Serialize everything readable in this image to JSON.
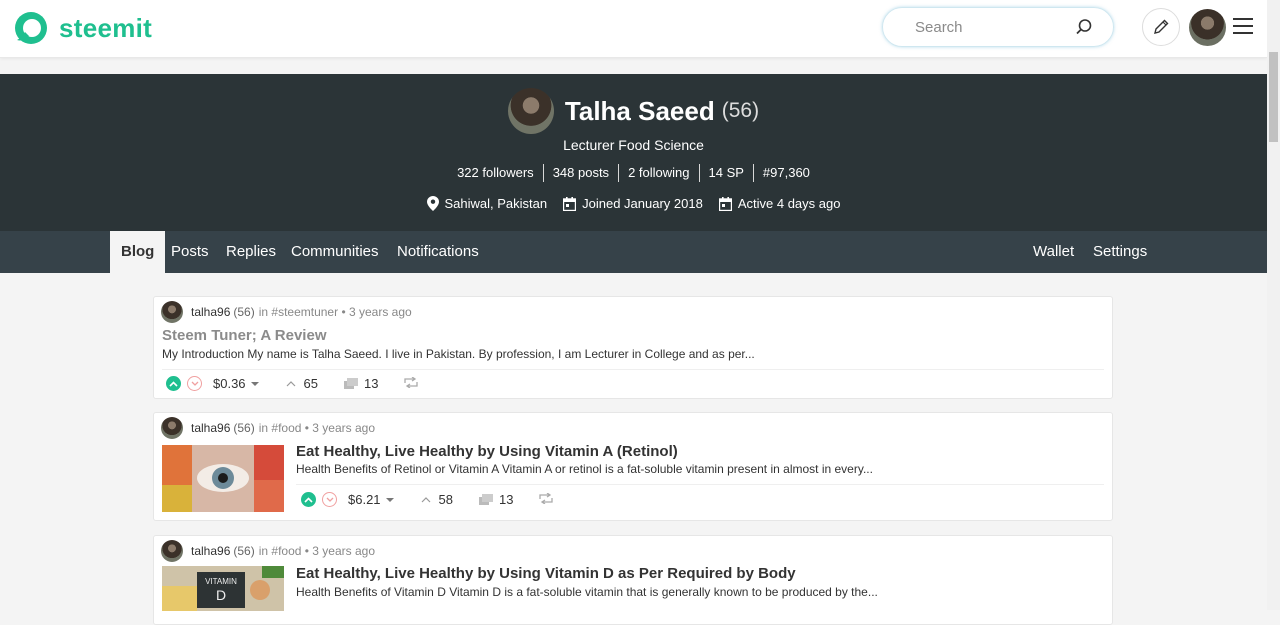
{
  "brand": {
    "name": "steemit",
    "color": "#1fbf8f"
  },
  "search": {
    "placeholder": "Search"
  },
  "header": {
    "pen_icon": "pencil-icon",
    "menu_icon": "hamburger-icon"
  },
  "profile": {
    "name": "Talha Saeed",
    "reputation": "(56)",
    "about": "Lecturer Food Science",
    "stats": [
      "322 followers",
      "348 posts",
      "2 following",
      "14 SP",
      "#97,360"
    ],
    "location": "Sahiwal, Pakistan",
    "joined": "Joined January 2018",
    "active": "Active 4 days ago"
  },
  "nav": {
    "left": [
      "Blog",
      "Posts",
      "Replies",
      "Communities",
      "Notifications"
    ],
    "right": [
      "Wallet",
      "Settings"
    ],
    "active": "Blog"
  },
  "posts": [
    {
      "author": "talha96",
      "rep": "(56)",
      "community": "in #steemtuner",
      "time": "• 3 years ago",
      "title": "Steem Tuner; A Review",
      "excerpt": "My Introduction My name is Talha Saeed. I live in Pakistan. By profession, I am Lecturer in College and as per...",
      "payout": "$0.36",
      "votes": "65",
      "comments": "13"
    },
    {
      "author": "talha96",
      "rep": "(56)",
      "community": "in #food",
      "time": "• 3 years ago",
      "title": "Eat Healthy, Live Healthy by Using Vitamin A (Retinol)",
      "excerpt": "Health Benefits of Retinol or Vitamin A Vitamin A or retinol is a fat-soluble vitamin present in almost in every...",
      "payout": "$6.21",
      "votes": "58",
      "comments": "13"
    },
    {
      "author": "talha96",
      "rep": "(56)",
      "community": "in #food",
      "time": "• 3 years ago",
      "title": "Eat Healthy, Live Healthy by Using Vitamin D as Per Required by Body",
      "excerpt": "Health Benefits of Vitamin D Vitamin D is a fat-soluble vitamin that is generally known to be produced by the...",
      "thumb_text": "VITAMIN D"
    }
  ]
}
